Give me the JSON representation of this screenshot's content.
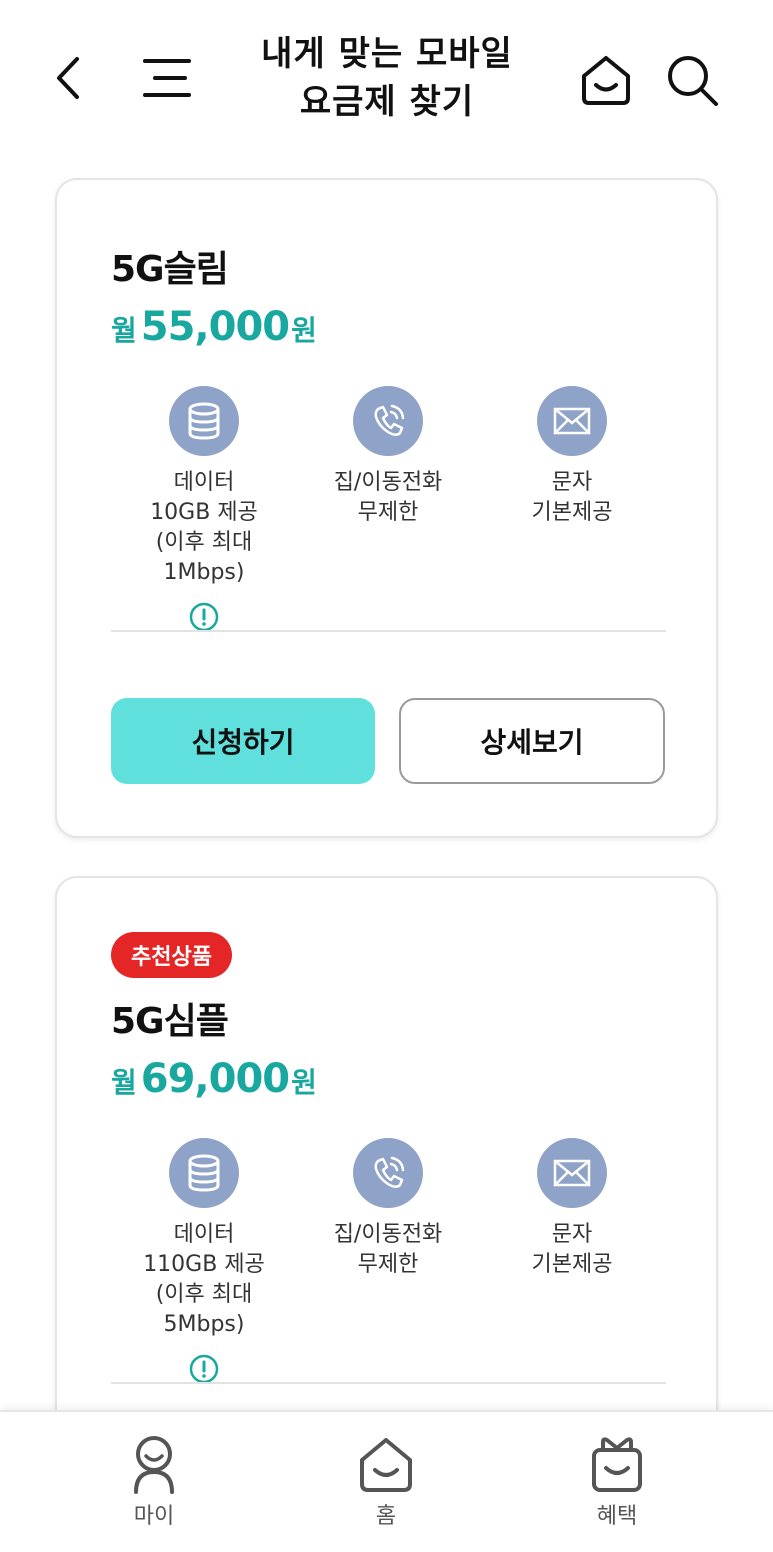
{
  "header": {
    "title_line1": "내게 맞는 모바일",
    "title_line2": "요금제 찾기",
    "icons": [
      "back-icon",
      "menu-icon",
      "home-icon",
      "search-icon"
    ]
  },
  "plans": [
    {
      "badge": "",
      "name": "5G슬림",
      "price_prefix": "월",
      "price": "55,000",
      "price_suffix": "원",
      "features": {
        "data": {
          "line1": "데이터",
          "line2": "10GB 제공",
          "line3": "(이후 최대 1Mbps)"
        },
        "call": {
          "line1": "집/이동전화",
          "line2": "무제한"
        },
        "sms": {
          "line1": "문자",
          "line2": "기본제공"
        }
      },
      "apply_label": "신청하기",
      "detail_label": "상세보기"
    },
    {
      "badge": "추천상품",
      "name": "5G심플",
      "price_prefix": "월",
      "price": "69,000",
      "price_suffix": "원",
      "features": {
        "data": {
          "line1": "데이터",
          "line2": "110GB 제공",
          "line3": "(이후 최대 5Mbps)"
        },
        "call": {
          "line1": "집/이동전화",
          "line2": "무제한"
        },
        "sms": {
          "line1": "문자",
          "line2": "기본제공"
        }
      }
    }
  ],
  "bottom_nav": {
    "my": "마이",
    "home": "홈",
    "benefit": "혜택"
  },
  "colors": {
    "accent_teal": "#18a8a0",
    "apply_button": "#5fe0dc",
    "badge_red": "#e52626",
    "feature_icon_bg": "#8ea3c7"
  }
}
